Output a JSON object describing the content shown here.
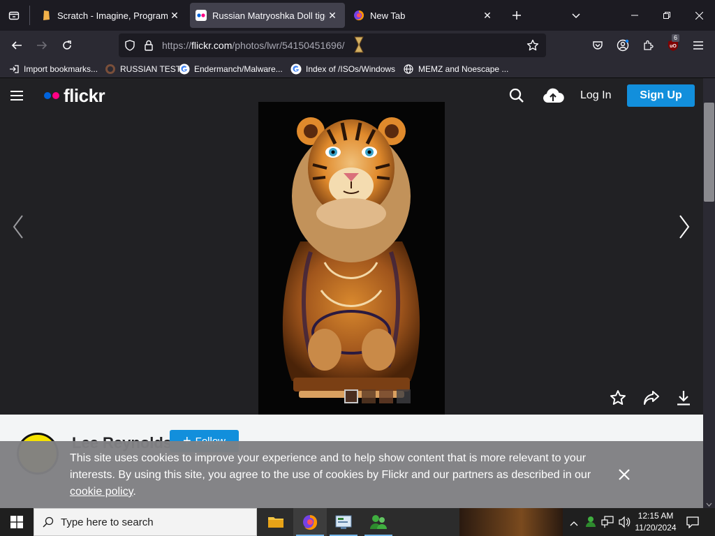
{
  "browser": {
    "tabs": [
      {
        "title": "Scratch - Imagine, Program, Sh",
        "active": false
      },
      {
        "title": "Russian Matryoshka Doll tiger |",
        "active": true
      },
      {
        "title": "New Tab",
        "active": false
      }
    ],
    "url": {
      "scheme": "https://",
      "domain": "flickr.com",
      "path": "/photos/lwr/54150451696/"
    },
    "extension_badge": "6",
    "bookmarks": [
      {
        "label": "Import bookmarks...",
        "icon": "import-icon"
      },
      {
        "label": "RUSSIAN TEST",
        "icon": "site-icon"
      },
      {
        "label": "Endermanch/Malware...",
        "icon": "google-icon"
      },
      {
        "label": "Index of /ISOs/Windows",
        "icon": "google-icon"
      },
      {
        "label": "MEMZ and Noescape ...",
        "icon": "globe-icon"
      }
    ]
  },
  "flickr": {
    "logo": "flickr",
    "login_label": "Log In",
    "signup_label": "Sign Up",
    "author_name": "Lee Reynolds",
    "follow_label": "Follow",
    "thumbnail_count": 4,
    "cookie_banner": {
      "text": "This site uses cookies to improve your experience and to help show content that is more relevant to your interests. By using this site, you agree to the use of cookies by Flickr and our partners as described in our ",
      "link": "cookie policy",
      "suffix": "."
    }
  },
  "taskbar": {
    "search_placeholder": "Type here to search",
    "time": "12:15 AM",
    "date": "11/20/2024"
  },
  "colors": {
    "flickr_blue": "#0063dc",
    "flickr_pink": "#ff0084",
    "signup_button": "#128fdc",
    "follow_button": "#128fdc"
  }
}
